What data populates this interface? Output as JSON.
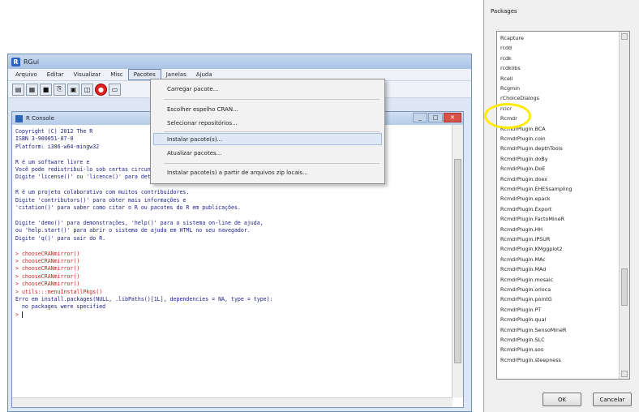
{
  "rgui": {
    "title": "RGui",
    "menus": [
      "Arquivo",
      "Editar",
      "Visualizar",
      "Misc",
      "Pacotes",
      "Janelas",
      "Ajuda"
    ],
    "toolbar_icons": [
      "open-script-icon",
      "load-workspace-icon",
      "save-icon",
      "copy-icon",
      "paste-icon",
      "copy-paste-icon",
      "stop-icon",
      "print-icon"
    ]
  },
  "console": {
    "title": "R Console",
    "lines": [
      {
        "text": "Copyright (C) 2012 The R",
        "color": "#1c1c8c"
      },
      {
        "text": "ISBN 3-900051-07-0",
        "color": "#1c1c8c"
      },
      {
        "text": "Platform: i386-w64-mingw32",
        "color": "#1c1c8c"
      },
      {
        "text": "",
        "color": "#1c1c8c"
      },
      {
        "text": "R é um software livre e",
        "color": "#1c1c8c"
      },
      {
        "text": "Você pode redistribuí-lo sob certas circunstâncias.",
        "color": "#1c1c8c"
      },
      {
        "text": "Digite 'license()' ou 'licence()' para detalhes de distribuição.",
        "color": "#1c1c8c"
      },
      {
        "text": "",
        "color": "#1c1c8c"
      },
      {
        "text": "R é um projeto colaborativo com muitos contribuidores.",
        "color": "#1c1c8c"
      },
      {
        "text": "Digite 'contributors()' para obter mais informações e",
        "color": "#1c1c8c"
      },
      {
        "text": "'citation()' para saber como citar o R ou pacotes do R em publicações.",
        "color": "#1c1c8c"
      },
      {
        "text": "",
        "color": "#1c1c8c"
      },
      {
        "text": "Digite 'demo()' para demonstrações, 'help()' para o sistema on-line de ajuda,",
        "color": "#1c1c8c"
      },
      {
        "text": "ou 'help.start()' para abrir o sistema de ajuda em HTML no seu navegador.",
        "color": "#1c1c8c"
      },
      {
        "text": "Digite 'q()' para sair do R.",
        "color": "#1c1c8c"
      },
      {
        "text": "",
        "color": "#1c1c8c"
      },
      {
        "text": "> chooseCRANmirror()",
        "color": "#d02020"
      },
      {
        "text": "> chooseCRANmirror()",
        "color": "#d02020"
      },
      {
        "text": "> chooseCRANmirror()",
        "color": "#d02020"
      },
      {
        "text": "> chooseCRANmirror()",
        "color": "#d02020"
      },
      {
        "text": "> chooseCRANmirror()",
        "color": "#d02020"
      },
      {
        "text": "> utils:::menuInstallPkgs()",
        "color": "#d02020"
      },
      {
        "text": "Erro em install.packages(NULL, .libPaths()[1L], dependencies = NA, type = type):",
        "color": "#1c1c8c"
      },
      {
        "text": "  no packages were specified",
        "color": "#1c1c8c"
      },
      {
        "text": "> ",
        "color": "#d02020"
      }
    ]
  },
  "pacotes_menu": {
    "items": [
      "Carregar pacote...",
      "Escolher espelho CRAN...",
      "Selecionar repositórios...",
      "Instalar pacote(s)...",
      "Atualizar pacotes...",
      "Instalar pacote(s) a partir de arquivos zip locais..."
    ],
    "highlighted_index": 3
  },
  "packages_dialog": {
    "title": "Packages",
    "items": [
      "Rcapture",
      "rcdd",
      "rcdk",
      "rcdklibs",
      "Rcell",
      "Rcgmin",
      "rChoiceDialogs",
      "rcicr",
      "Rcmdr",
      "RcmdrPlugin.BCA",
      "RcmdrPlugin.coin",
      "RcmdrPlugin.depthTools",
      "RcmdrPlugin.doBy",
      "RcmdrPlugin.DoE",
      "RcmdrPlugin.doex",
      "RcmdrPlugin.EHESsampling",
      "RcmdrPlugin.epack",
      "RcmdrPlugin.Export",
      "RcmdrPlugin.FactoMineR",
      "RcmdrPlugin.HH",
      "RcmdrPlugin.IPSUR",
      "RcmdrPlugin.KMggplot2",
      "RcmdrPlugin.MAc",
      "RcmdrPlugin.MAd",
      "RcmdrPlugin.mosaic",
      "RcmdrPlugin.orloca",
      "RcmdrPlugin.pointG",
      "RcmdrPlugin.PT",
      "RcmdrPlugin.qual",
      "RcmdrPlugin.SensoMineR",
      "RcmdrPlugin.SLC",
      "RcmdrPlugin.sos",
      "RcmdrPlugin.steepness"
    ],
    "ok_label": "OK",
    "cancel_label": "Cancelar",
    "highlight_color": "#ffea00"
  }
}
